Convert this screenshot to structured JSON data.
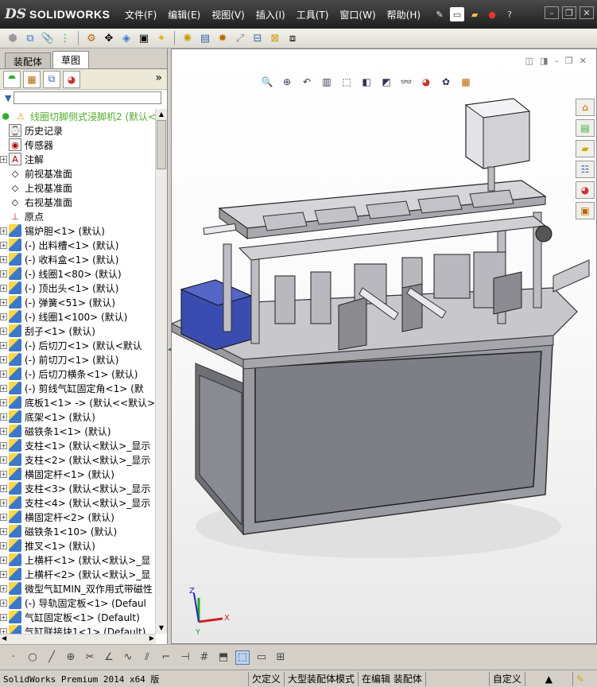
{
  "app": {
    "logo_ds": "DS",
    "logo_name": "SOLIDWORKS"
  },
  "menu": [
    "文件(F)",
    "编辑(E)",
    "视图(V)",
    "插入(I)",
    "工具(T)",
    "窗口(W)",
    "帮助(H)"
  ],
  "left": {
    "tabs": [
      "装配体",
      "草图"
    ],
    "more": "»"
  },
  "tree": [
    {
      "label": "线圈切脚侧式浸脚机2  (默认<",
      "icon": "assembly-warning-icon",
      "exp": false,
      "top": true
    },
    {
      "label": "历史记录",
      "icon": "history-icon",
      "exp": false
    },
    {
      "label": "传感器",
      "icon": "sensor-icon",
      "exp": false
    },
    {
      "label": "注解",
      "icon": "annotation-icon",
      "exp": true
    },
    {
      "label": "前视基准面",
      "icon": "plane-icon",
      "exp": false
    },
    {
      "label": "上视基准面",
      "icon": "plane-icon",
      "exp": false
    },
    {
      "label": "右视基准面",
      "icon": "plane-icon",
      "exp": false
    },
    {
      "label": "原点",
      "icon": "origin-icon",
      "exp": false
    },
    {
      "label": "锡炉胆<1> (默认)",
      "icon": "part-icon",
      "exp": true
    },
    {
      "label": "(-) 出料槽<1> (默认)",
      "icon": "part-icon",
      "exp": true
    },
    {
      "label": "(-) 收料盒<1> (默认)",
      "icon": "part-icon",
      "exp": true
    },
    {
      "label": "(-) 线圈1<80> (默认)",
      "icon": "part-icon",
      "exp": true
    },
    {
      "label": "(-) 顶出头<1> (默认)",
      "icon": "part-icon",
      "exp": true
    },
    {
      "label": "(-) 弹簧<51> (默认)",
      "icon": "part-icon",
      "exp": true
    },
    {
      "label": "(-) 线圈1<100> (默认)",
      "icon": "part-icon",
      "exp": true
    },
    {
      "label": "刮子<1> (默认)",
      "icon": "part-icon",
      "exp": true
    },
    {
      "label": "(-) 后切刀<1> (默认<默认",
      "icon": "part-icon",
      "exp": true
    },
    {
      "label": "(-) 前切刀<1> (默认)",
      "icon": "part-icon",
      "exp": true
    },
    {
      "label": "(-) 后切刀横条<1> (默认)",
      "icon": "part-icon",
      "exp": true
    },
    {
      "label": "(-) 剪线气缸固定角<1> (默",
      "icon": "part-icon",
      "exp": true
    },
    {
      "label": "底板1<1> -> (默认<<默认>_",
      "icon": "part-icon",
      "exp": true
    },
    {
      "label": "底架<1> (默认)",
      "icon": "part-icon",
      "exp": true
    },
    {
      "label": "磁铁条1<1> (默认)",
      "icon": "part-icon",
      "exp": true
    },
    {
      "label": "支柱<1> (默认<默认>_显示",
      "icon": "part-icon",
      "exp": true
    },
    {
      "label": "支柱<2> (默认<默认>_显示",
      "icon": "part-icon",
      "exp": true
    },
    {
      "label": "横固定杆<1> (默认)",
      "icon": "part-icon",
      "exp": true
    },
    {
      "label": "支柱<3> (默认<默认>_显示",
      "icon": "part-icon",
      "exp": true
    },
    {
      "label": "支柱<4> (默认<默认>_显示",
      "icon": "part-icon",
      "exp": true
    },
    {
      "label": "横固定杆<2> (默认)",
      "icon": "part-icon",
      "exp": true
    },
    {
      "label": "磁铁条1<10> (默认)",
      "icon": "part-icon",
      "exp": true
    },
    {
      "label": "推叉<1> (默认)",
      "icon": "part-icon",
      "exp": true
    },
    {
      "label": "上横杆<1> (默认<默认>_显",
      "icon": "part-icon",
      "exp": true
    },
    {
      "label": "上横杆<2> (默认<默认>_显",
      "icon": "part-icon",
      "exp": true
    },
    {
      "label": "微型气缸MIN_双作用式带磁性",
      "icon": "part-icon",
      "exp": true
    },
    {
      "label": "(-) 导轨固定板<1> (Defaul",
      "icon": "part-icon",
      "exp": true
    },
    {
      "label": "气缸固定板<1> (Default)",
      "icon": "part-icon",
      "exp": true
    },
    {
      "label": "气缸联接块1<1> (Default)",
      "icon": "part-icon",
      "exp": true
    }
  ],
  "triad": {
    "x": "X",
    "y": "Y",
    "z": "Z"
  },
  "status": {
    "product": "SolidWorks Premium 2014 x64 版",
    "s1": "欠定义",
    "s2": "大型装配体模式",
    "s3": "在编辑 装配体",
    "s4": "自定义",
    "s5": "▲"
  },
  "colors": {
    "titlebar": "#2b2b2b",
    "frame": "#c0c0c8",
    "accent_blue": "#3a4cb0",
    "cabinet": "#7d7d85",
    "panel_dark": "#4a4a52"
  }
}
